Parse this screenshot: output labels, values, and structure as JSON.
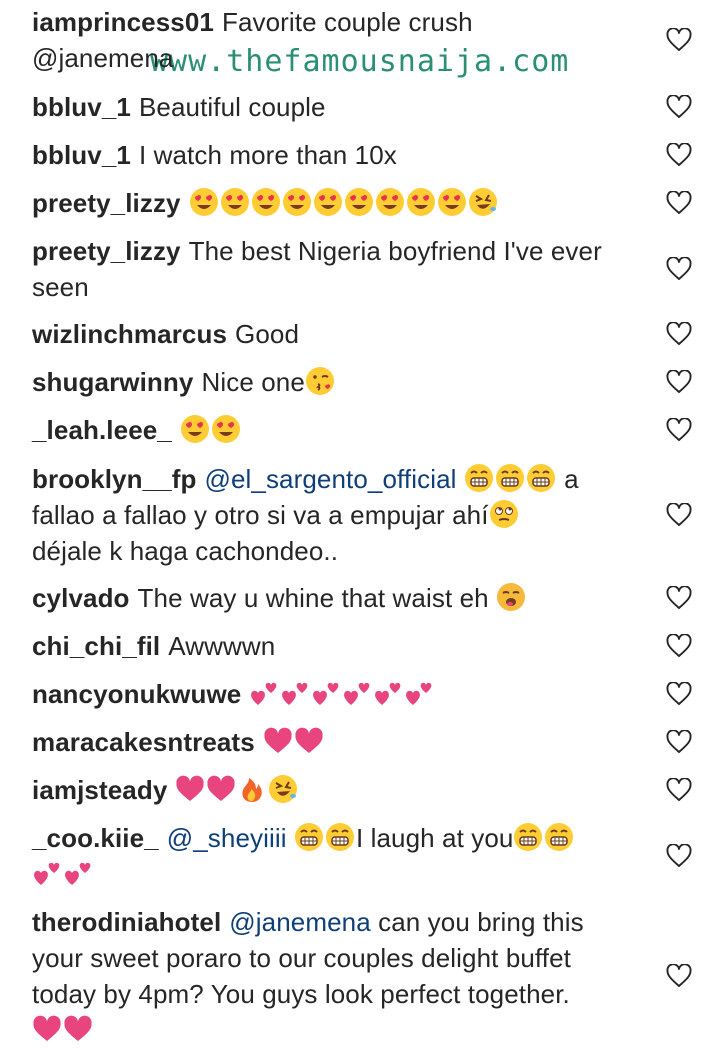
{
  "watermark": "www.thefamousnaija.com",
  "comments": [
    {
      "user": "iamprincess01",
      "text": "Favorite couple crush",
      "text2": "@janemena"
    },
    {
      "user": "bbluv_1",
      "text": "Beautiful couple"
    },
    {
      "user": "bbluv_1",
      "text": "I watch more than 10x"
    },
    {
      "user": "preety_lizzy",
      "emojis": [
        "heart-eyes",
        "heart-eyes",
        "heart-eyes",
        "heart-eyes",
        "heart-eyes",
        "heart-eyes",
        "heart-eyes",
        "heart-eyes",
        "heart-eyes",
        "rofl"
      ]
    },
    {
      "user": "preety_lizzy",
      "text": "The best Nigeria boyfriend I've ever seen"
    },
    {
      "user": "wizlinchmarcus",
      "text": "Good"
    },
    {
      "user": "shugarwinny",
      "text": "Nice one",
      "emojis": [
        "kiss-wink"
      ]
    },
    {
      "user": "_leah.leee_",
      "emojis": [
        "heart-eyes",
        "heart-eyes"
      ]
    },
    {
      "user": "brooklyn__fp",
      "mention": "@el_sargento_official",
      "text": "a fallao a fallao y otro si va a empujar ahí",
      "text2": "déjale k haga cachondeo.."
    },
    {
      "user": "cylvado",
      "text": "The way u whine that waist eh"
    },
    {
      "user": "chi_chi_fil",
      "text": "Awwwwn"
    },
    {
      "user": "nancyonukwuwe",
      "emojis": [
        "two-hearts",
        "two-hearts",
        "two-hearts",
        "two-hearts",
        "two-hearts",
        "two-hearts"
      ]
    },
    {
      "user": "maracakesntreats",
      "emojis": [
        "heart",
        "heart"
      ]
    },
    {
      "user": "iamjsteady",
      "emojis": [
        "heart",
        "heart",
        "fire",
        "rofl"
      ]
    },
    {
      "user": "_coo.kiie_",
      "mention": "@_sheyiiii",
      "text": "I laugh at you"
    },
    {
      "user": "therodiniahotel",
      "mention": "@janemena",
      "text": "can you bring this your sweet poraro to our couples delight buffet today by 4pm? You guys look perfect together."
    }
  ],
  "icons": {
    "like": "heart-outline-icon"
  },
  "colors": {
    "text": "#262626",
    "mention": "#0f3f79",
    "watermark": "#2a8f74",
    "heart_emoji": "#e8457e"
  }
}
